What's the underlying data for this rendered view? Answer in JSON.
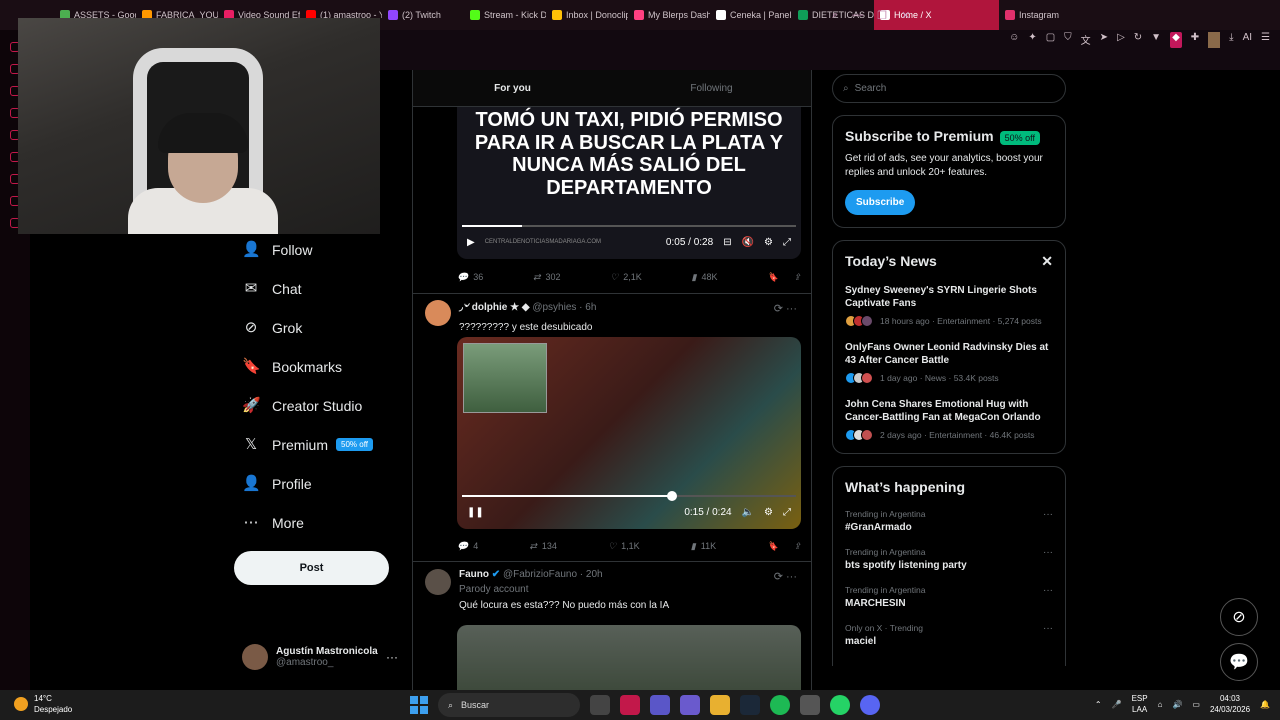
{
  "browser": {
    "tabs": [
      {
        "label": "ASSETS - Goog",
        "color": "#4caf50"
      },
      {
        "label": "FABRICA_YOUT",
        "color": "#ff9800"
      },
      {
        "label": "Video Sound Ef",
        "color": "#e91e63"
      },
      {
        "label": "(1) amastroo - Y",
        "color": "#ff0000"
      },
      {
        "label": "(2) Twitch",
        "color": "#9146ff"
      },
      {
        "label": "Stream - Kick D",
        "color": "#53fc18"
      },
      {
        "label": "Inbox | Donoclip",
        "color": "#ffc107"
      },
      {
        "label": "My Blerps Dash",
        "color": "#ff4081"
      },
      {
        "label": "Ceneka | Panel",
        "color": "#ffffff"
      },
      {
        "label": "DIETETICAS Di",
        "color": "#0f9d58"
      },
      {
        "label": "Home / X",
        "color": "#ffffff"
      },
      {
        "label": "Instagram",
        "color": "#e1306c"
      }
    ],
    "new_tab": "+",
    "ai_label": "AI"
  },
  "nav": {
    "items": [
      {
        "label": "Follow",
        "icon": "follow-icon",
        "glyph": "👤"
      },
      {
        "label": "Chat",
        "icon": "chat-icon",
        "glyph": "✉"
      },
      {
        "label": "Grok",
        "icon": "grok-icon",
        "glyph": "⊘"
      },
      {
        "label": "Bookmarks",
        "icon": "bookmark-icon",
        "glyph": "🔖"
      },
      {
        "label": "Creator Studio",
        "icon": "rocket-icon",
        "glyph": "🚀"
      },
      {
        "label": "Premium",
        "icon": "x-logo-icon",
        "glyph": "𝕏",
        "badge": "50% off"
      },
      {
        "label": "Profile",
        "icon": "profile-icon",
        "glyph": "👤"
      },
      {
        "label": "More",
        "icon": "more-icon",
        "glyph": "⋯"
      }
    ],
    "post_label": "Post",
    "account": {
      "name": "Agustín Mastronicola",
      "handle": "@amastroo_",
      "menu": "···"
    }
  },
  "feed": {
    "tabs": [
      "For you",
      "Following"
    ],
    "post1": {
      "headline": "TOMÓ UN TAXI, PIDIÓ PERMISO PARA IR A BUSCAR LA PLATA Y NUNCA MÁS SALIÓ DEL DEPARTAMENTO",
      "watermark": "CENTRALDENOTICIASMADARIAGA.COM",
      "time": "0:05 / 0:28",
      "progress": 0.18,
      "replies": "36",
      "reposts": "302",
      "likes": "2,1K",
      "views": "48K"
    },
    "post2": {
      "name": "◞৺ dolphie ★ ◆",
      "handle": "@psyhies · 6h",
      "text": "????????? y este desubicado",
      "time": "0:15 / 0:24",
      "progress": 0.63,
      "replies": "4",
      "reposts": "134",
      "likes": "1,1K",
      "views": "11K"
    },
    "post3": {
      "name": "Fauno",
      "handle": "@FabrizioFauno · 20h",
      "sub": "Parody account",
      "text": "Qué locura es esta??? No puedo más con la IA"
    }
  },
  "sidebar": {
    "search_placeholder": "Search",
    "premium": {
      "title": "Subscribe to Premium",
      "badge": "50% off",
      "text": "Get rid of ads, see your analytics, boost your replies and unlock 20+ features.",
      "button": "Subscribe"
    },
    "news": {
      "title": "Today’s News",
      "items": [
        {
          "title": "Sydney Sweeney's SYRN Lingerie Shots Captivate Fans",
          "meta": "18 hours ago · Entertainment · 5,274 posts"
        },
        {
          "title": "OnlyFans Owner Leonid Radvinsky Dies at 43 After Cancer Battle",
          "meta": "1 day ago · News · 53.4K posts"
        },
        {
          "title": "John Cena Shares Emotional Hug with Cancer-Battling Fan at MegaCon Orlando",
          "meta": "2 days ago · Entertainment · 46.4K posts"
        }
      ]
    },
    "happening": {
      "title": "What’s happening",
      "items": [
        {
          "context": "Trending in Argentina",
          "topic": "#GranArmado"
        },
        {
          "context": "Trending in Argentina",
          "topic": "bts spotify listening party"
        },
        {
          "context": "Trending in Argentina",
          "topic": "MARCHESIN"
        },
        {
          "context": "Only on X · Trending",
          "topic": "maciel"
        }
      ]
    }
  },
  "taskbar": {
    "temp": "14°C",
    "weather": "Despejado",
    "search": "Buscar",
    "lang1": "ESP",
    "lang2": "LAA",
    "time": "04:03",
    "date": "24/03/2026"
  }
}
